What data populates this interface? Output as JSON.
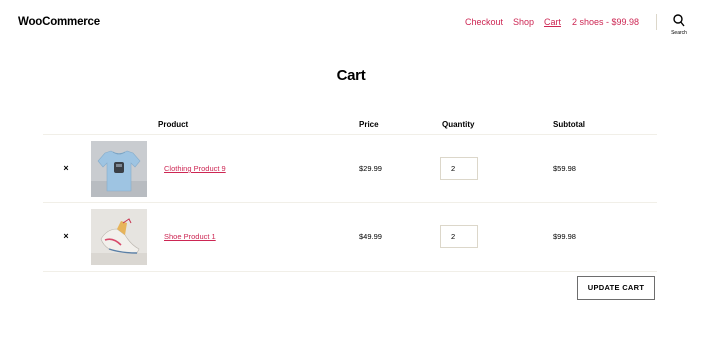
{
  "header": {
    "site_title": "WooCommerce",
    "nav": {
      "checkout": "Checkout",
      "shop": "Shop",
      "cart": "Cart",
      "mini_cart": "2 shoes - $99.98"
    },
    "search_label": "Search",
    "link_color": "#cd2653"
  },
  "page": {
    "title": "Cart"
  },
  "cart": {
    "columns": {
      "product": "Product",
      "price": "Price",
      "quantity": "Quantity",
      "subtotal": "Subtotal"
    },
    "items": [
      {
        "remove_icon": "×",
        "name": "Clothing Product 9",
        "price": "$29.99",
        "quantity": "2",
        "subtotal": "$59.98",
        "image": "t-shirt-icon"
      },
      {
        "remove_icon": "×",
        "name": "Shoe Product 1",
        "price": "$49.99",
        "quantity": "2",
        "subtotal": "$99.98",
        "image": "shoe-icon"
      }
    ],
    "update_label": "UPDATE CART"
  }
}
